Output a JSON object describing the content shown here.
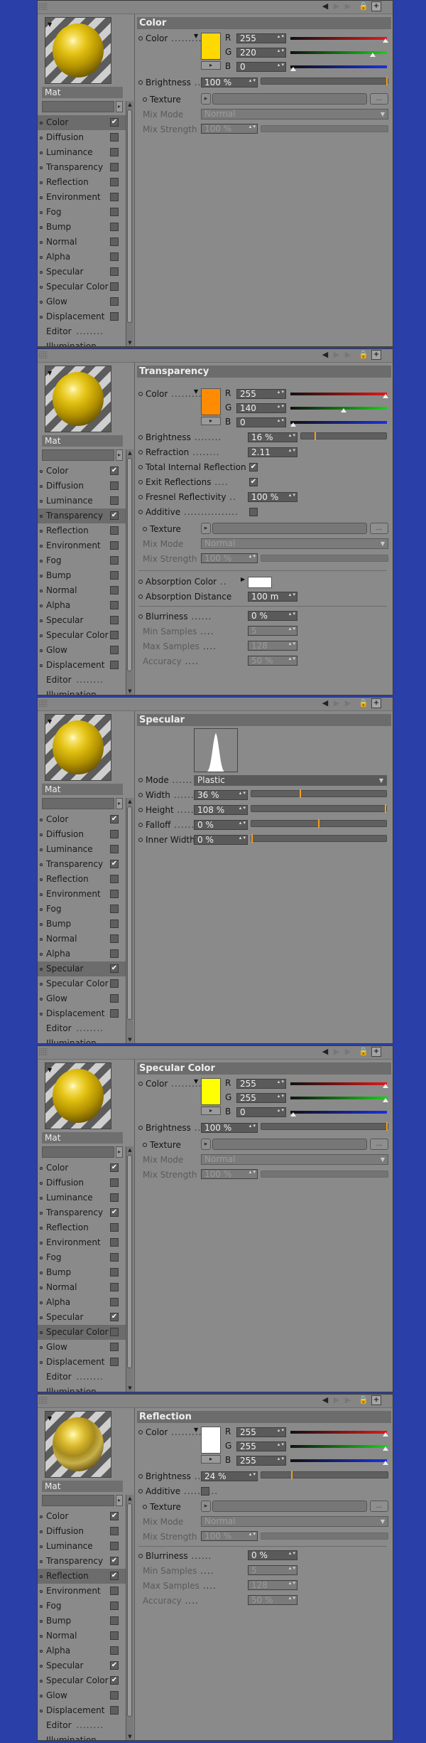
{
  "material_name": "Mat",
  "channels": [
    "Color",
    "Diffusion",
    "Luminance",
    "Transparency",
    "Reflection",
    "Environment",
    "Fog",
    "Bump",
    "Normal",
    "Alpha",
    "Specular",
    "Specular Color",
    "Glow",
    "Displacement",
    "Editor",
    "Illumination"
  ],
  "panels": [
    {
      "header": "Color",
      "selected": "Color",
      "checked": [
        "Color"
      ],
      "preview": "standard",
      "props": {
        "color_label": "Color",
        "r_label": "R",
        "g_label": "G",
        "b_label": "B",
        "r": "255",
        "g": "220",
        "b": "0",
        "swatch": "#ffd800",
        "brightness_label": "Brightness",
        "brightness": "100 %",
        "texture_label": "Texture",
        "mixmode_label": "Mix Mode",
        "mixmode": "Normal",
        "mixstrength_label": "Mix Strength",
        "mixstrength": "100 %"
      }
    },
    {
      "header": "Transparency",
      "selected": "Transparency",
      "checked": [
        "Color",
        "Transparency"
      ],
      "preview": "standard",
      "props": {
        "color_label": "Color",
        "r_label": "R",
        "g_label": "G",
        "b_label": "B",
        "r": "255",
        "g": "140",
        "b": "0",
        "swatch": "#ff8c00",
        "brightness_label": "Brightness",
        "brightness": "16 %",
        "refraction_label": "Refraction",
        "refraction": "2.11",
        "tir_label": "Total Internal Reflection",
        "exit_label": "Exit Reflections",
        "fresnel_label": "Fresnel Reflectivity",
        "fresnel": "100 %",
        "additive_label": "Additive",
        "texture_label": "Texture",
        "mixmode_label": "Mix Mode",
        "mixmode": "Normal",
        "mixstrength_label": "Mix Strength",
        "mixstrength": "100 %",
        "abs_color_label": "Absorption Color",
        "abs_dist_label": "Absorption Distance",
        "abs_dist": "100 m",
        "blur_label": "Blurriness",
        "blur": "0 %",
        "minsamp_label": "Min Samples",
        "minsamp": "5",
        "maxsamp_label": "Max Samples",
        "maxsamp": "128",
        "accuracy_label": "Accuracy",
        "accuracy": "50 %"
      }
    },
    {
      "header": "Specular",
      "selected": "Specular",
      "checked": [
        "Color",
        "Transparency",
        "Specular"
      ],
      "preview": "standard",
      "props": {
        "mode_label": "Mode",
        "mode": "Plastic",
        "width_label": "Width",
        "width": "36 %",
        "height_label": "Height",
        "height": "108 %",
        "falloff_label": "Falloff",
        "falloff": "0 %",
        "inner_label": "Inner Width",
        "inner": "0 %"
      }
    },
    {
      "header": "Specular Color",
      "selected": "Specular Color",
      "checked": [
        "Color",
        "Transparency",
        "Specular"
      ],
      "preview": "standard",
      "props": {
        "color_label": "Color",
        "r_label": "R",
        "g_label": "G",
        "b_label": "B",
        "r": "255",
        "g": "255",
        "b": "0",
        "swatch": "#ffff00",
        "brightness_label": "Brightness",
        "brightness": "100 %",
        "texture_label": "Texture",
        "mixmode_label": "Mix Mode",
        "mixmode": "Normal",
        "mixstrength_label": "Mix Strength",
        "mixstrength": "100 %"
      }
    },
    {
      "header": "Reflection",
      "selected": "Reflection",
      "checked": [
        "Color",
        "Transparency",
        "Reflection",
        "Specular",
        "Specular Color"
      ],
      "preview": "reflective",
      "props": {
        "color_label": "Color",
        "r_label": "R",
        "g_label": "G",
        "b_label": "B",
        "r": "255",
        "g": "255",
        "b": "255",
        "swatch": "#ffffff",
        "brightness_label": "Brightness",
        "brightness": "24 %",
        "additive_label": "Additive",
        "texture_label": "Texture",
        "mixmode_label": "Mix Mode",
        "mixmode": "Normal",
        "mixstrength_label": "Mix Strength",
        "mixstrength": "100 %",
        "blur_label": "Blurriness",
        "blur": "0 %",
        "minsamp_label": "Min Samples",
        "minsamp": "5",
        "maxsamp_label": "Max Samples",
        "maxsamp": "128",
        "accuracy_label": "Accuracy",
        "accuracy": "50 %"
      }
    }
  ]
}
